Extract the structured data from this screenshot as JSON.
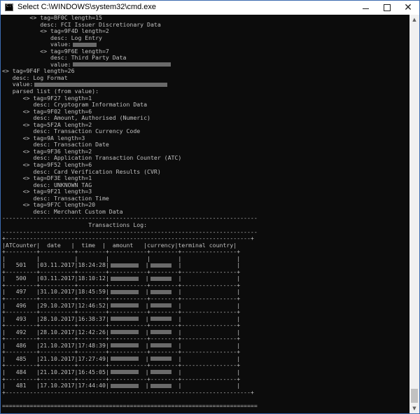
{
  "window": {
    "title": "Select C:\\WINDOWS\\system32\\cmd.exe",
    "minimize_glyph": "—",
    "maximize_glyph": "☐",
    "close_glyph": "✕"
  },
  "console": {
    "lines": [
      {
        "text": "        <> tag=BF0C length=15"
      },
      {
        "text": "           desc: FCI Issuer Discretionary Data"
      },
      {
        "text": "           <> tag=9F4D length=2"
      },
      {
        "text": "              desc: Log Entry"
      },
      {
        "text": "              value:",
        "redact": "sm"
      },
      {
        "text": "           <> tag=9F6E length=7"
      },
      {
        "text": "              desc: Third Party Data"
      },
      {
        "text": "              value:",
        "redact": "md"
      },
      {
        "text": "<> tag=9F4F length=26"
      },
      {
        "text": "   desc: Log Format"
      },
      {
        "text": "   value:",
        "redact": "lg"
      },
      {
        "text": "   parsed list (from value):"
      },
      {
        "text": "      <> tag=9F27 length=1"
      },
      {
        "text": "         desc: Cryptogram Information Data"
      },
      {
        "text": "      <> tag=9F02 length=6"
      },
      {
        "text": "         desc: Amount, Authorised (Numeric)"
      },
      {
        "text": "      <> tag=5F2A length=2"
      },
      {
        "text": "         desc: Transaction Currency Code"
      },
      {
        "text": "      <> tag=9A length=3"
      },
      {
        "text": "         desc: Transaction Date"
      },
      {
        "text": "      <> tag=9F36 length=2"
      },
      {
        "text": "         desc: Application Transaction Counter (ATC)"
      },
      {
        "text": "      <> tag=9F52 length=6"
      },
      {
        "text": "         desc: Card Verification Results (CVR)"
      },
      {
        "text": "      <> tag=DF3E length=1"
      },
      {
        "text": "         desc: UNKNOWN TAG"
      },
      {
        "text": "      <> tag=9F21 length=3"
      },
      {
        "text": "         desc: Transaction Time"
      },
      {
        "text": "      <> tag=9F7C length=20"
      },
      {
        "text": "         desc: Merchant Custom Data"
      },
      {
        "text": "--------------------------------------------------------------------------"
      },
      {
        "text": "                         Transactions Log:"
      },
      {
        "text": "--------------------------------------------------------------------------"
      },
      {
        "text": "+-----------------------------------------------------------------------+"
      },
      {
        "text": "|ATCounter|  date   |  time  |  amount   |currency|terminal country|"
      },
      {
        "text": "+---------+----------+--------+-----------+--------+----------------+"
      },
      {
        "text": "|         |          |        |           |        |                |"
      },
      {
        "text": "|   501   |03.11.2017|18:24:28|",
        "redact": "amt",
        "tail": "  |",
        "redact2": "cur",
        "tail2": "  |                |"
      },
      {
        "text": "+---------+----------+--------+-----------+--------+----------------+"
      },
      {
        "text": "|   500   |03.11.2017|18:10:12|",
        "redact": "amt",
        "tail": "  |",
        "redact2": "cur",
        "tail2": "  |                |"
      },
      {
        "text": "+---------+----------+--------+-----------+--------+----------------+"
      },
      {
        "text": "|   497   |31.10.2017|18:45:59|",
        "redact": "amt",
        "tail": "  |",
        "redact2": "cur",
        "tail2": "  |                |"
      },
      {
        "text": "+---------+----------+--------+-----------+--------+----------------+"
      },
      {
        "text": "|   496   |29.10.2017|12:46:52|",
        "redact": "amt",
        "tail": "  |",
        "redact2": "cur",
        "tail2": "  |                |"
      },
      {
        "text": "+---------+----------+--------+-----------+--------+----------------+"
      },
      {
        "text": "|   493   |28.10.2017|16:38:37|",
        "redact": "amt",
        "tail": "  |",
        "redact2": "cur",
        "tail2": "  |                |"
      },
      {
        "text": "+---------+----------+--------+-----------+--------+----------------+"
      },
      {
        "text": "|   492   |28.10.2017|12:42:26|",
        "redact": "amt",
        "tail": "  |",
        "redact2": "cur",
        "tail2": "  |                |"
      },
      {
        "text": "+---------+----------+--------+-----------+--------+----------------+"
      },
      {
        "text": "|   486   |21.10.2017|17:48:39|",
        "redact": "amt",
        "tail": "  |",
        "redact2": "cur",
        "tail2": "  |                |"
      },
      {
        "text": "+---------+----------+--------+-----------+--------+----------------+"
      },
      {
        "text": "|   485   |21.10.2017|17:27:49|",
        "redact": "amt",
        "tail": "  |",
        "redact2": "cur",
        "tail2": "  |                |"
      },
      {
        "text": "+---------+----------+--------+-----------+--------+----------------+"
      },
      {
        "text": "|   484   |21.10.2017|16:45:05|",
        "redact": "amt",
        "tail": "  |",
        "redact2": "cur",
        "tail2": "  |                |"
      },
      {
        "text": "+---------+----------+--------+-----------+--------+----------------+"
      },
      {
        "text": "|   481   |17.10.2017|17:44:40|",
        "redact": "amt",
        "tail": "  |",
        "redact2": "cur",
        "tail2": "  |                |"
      },
      {
        "text": "+-----------------------------------------------------------------------+"
      },
      {
        "text": ""
      },
      {
        "text": "=========================================================================="
      }
    ]
  }
}
